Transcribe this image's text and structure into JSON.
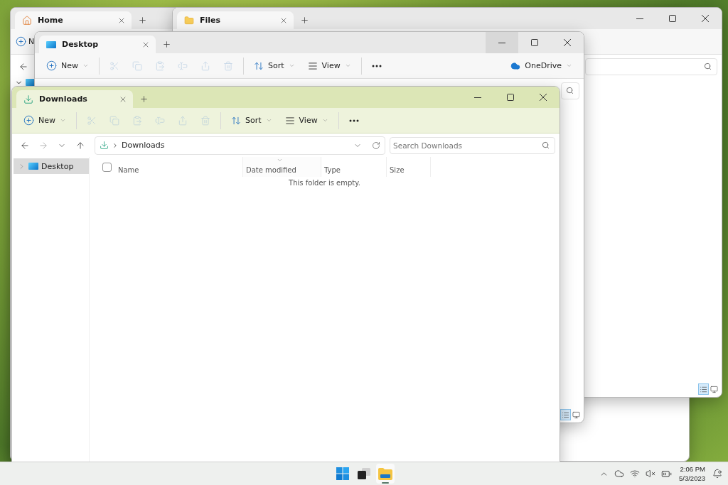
{
  "home_window": {
    "active": false,
    "tabs": [
      {
        "kind": "home",
        "label": "Home",
        "selected": true
      }
    ],
    "toolbar": [
      {
        "kind": "new",
        "label": "N"
      }
    ],
    "nav": [
      {
        "kind": "back",
        "disabled": false
      }
    ],
    "tree": [
      {
        "expanded": true
      }
    ]
  },
  "files_window": {
    "active": false,
    "tabs": [
      {
        "kind": "folder",
        "label": "Files",
        "selected": true
      }
    ],
    "controls": [
      {
        "kind": "minimize",
        "hovered": false
      },
      {
        "kind": "maximize",
        "hovered": false
      },
      {
        "kind": "close",
        "hovered": false
      }
    ],
    "search": {
      "kind": "field"
    },
    "view_modes": [
      {
        "kind": "details",
        "selected": true
      },
      {
        "kind": "tiles",
        "selected": false
      }
    ]
  },
  "desktop_window": {
    "active": false,
    "tabs": [
      {
        "kind": "desktop",
        "label": "Desktop",
        "selected": true
      }
    ],
    "controls": [
      {
        "kind": "minimize",
        "hovered": true
      },
      {
        "kind": "maximize",
        "hovered": false
      },
      {
        "kind": "close",
        "hovered": false
      }
    ],
    "toolbar": [
      {
        "kind": "new",
        "label": "New",
        "disabled": false
      },
      {
        "kind": "cut",
        "disabled": true
      },
      {
        "kind": "copy",
        "disabled": true
      },
      {
        "kind": "paste",
        "disabled": true
      },
      {
        "kind": "rename",
        "disabled": true
      },
      {
        "kind": "share",
        "disabled": true
      },
      {
        "kind": "delete",
        "disabled": true
      },
      {
        "kind": "sort",
        "label": "Sort",
        "disabled": false
      },
      {
        "kind": "view",
        "label": "View",
        "disabled": false
      },
      {
        "kind": "more",
        "disabled": false
      }
    ],
    "trailing": {
      "kind": "onedrive",
      "label": "OneDrive"
    },
    "search": {
      "kind": "covered"
    },
    "view_modes": [
      {
        "kind": "details",
        "selected": true
      },
      {
        "kind": "tiles",
        "selected": false
      }
    ]
  },
  "downloads_window": {
    "active": true,
    "tabs": [
      {
        "kind": "download",
        "label": "Downloads",
        "selected": true
      }
    ],
    "controls": [
      {
        "kind": "minimize",
        "hovered": false
      },
      {
        "kind": "maximize",
        "hovered": false
      },
      {
        "kind": "close",
        "hovered": false
      }
    ],
    "toolbar": [
      {
        "kind": "new",
        "label": "New",
        "disabled": false
      },
      {
        "kind": "cut",
        "disabled": true
      },
      {
        "kind": "copy",
        "disabled": true
      },
      {
        "kind": "paste",
        "disabled": true
      },
      {
        "kind": "rename",
        "disabled": true
      },
      {
        "kind": "share",
        "disabled": true
      },
      {
        "kind": "delete",
        "disabled": true
      },
      {
        "kind": "sort",
        "label": "Sort",
        "disabled": false
      },
      {
        "kind": "view",
        "label": "View",
        "disabled": false
      },
      {
        "kind": "more",
        "disabled": false
      }
    ],
    "nav": [
      {
        "kind": "back",
        "disabled": false
      },
      {
        "kind": "forward",
        "disabled": true
      },
      {
        "kind": "recent",
        "disabled": false
      },
      {
        "kind": "up",
        "disabled": false
      }
    ],
    "breadcrumb": [
      "Downloads"
    ],
    "search": {
      "kind": "field",
      "placeholder": "Search Downloads"
    },
    "tree": [
      {
        "label": "Desktop",
        "expanded": false,
        "selected": true
      }
    ],
    "select_all": {
      "checked": false
    },
    "columns": [
      {
        "label": "Name",
        "sorted": false
      },
      {
        "label": "Date modified",
        "sorted": true
      },
      {
        "label": "Type",
        "sorted": false
      },
      {
        "label": "Size",
        "sorted": false
      }
    ],
    "empty_message": "This folder is empty."
  },
  "taskbar": {
    "apps": [
      {
        "kind": "start",
        "active": false
      },
      {
        "kind": "taskview",
        "active": false
      },
      {
        "kind": "explorer",
        "active": true
      }
    ],
    "tray": [
      {
        "kind": "overflow"
      },
      {
        "kind": "onedrive"
      },
      {
        "kind": "wifi"
      },
      {
        "kind": "volume-muted"
      },
      {
        "kind": "battery"
      }
    ],
    "time": "2:06 PM",
    "date": "5/3/2023",
    "notifications": {
      "kind": "bell"
    }
  }
}
